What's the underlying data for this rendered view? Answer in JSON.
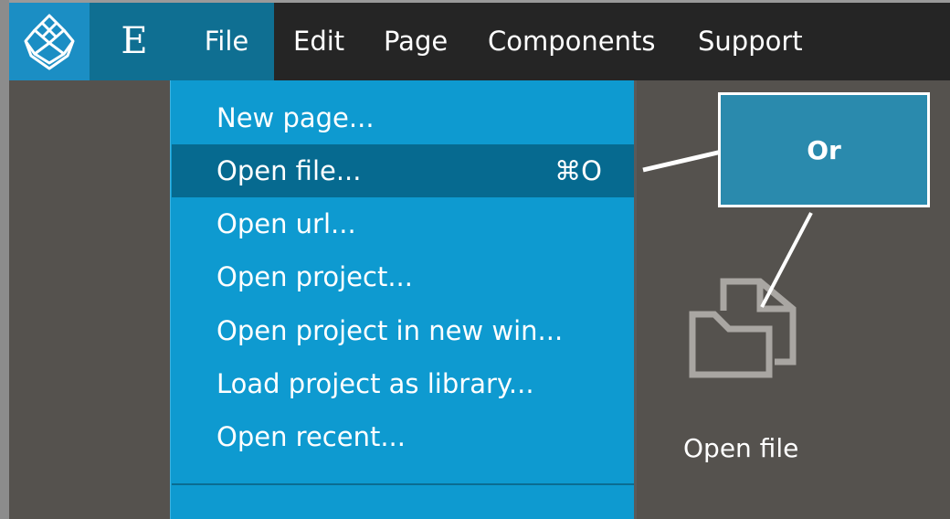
{
  "menubar": {
    "logo_icon": "pinecone-logo-icon",
    "e_tile": "E",
    "file": "File",
    "edit": "Edit",
    "page": "Page",
    "components": "Components",
    "support": "Support"
  },
  "file_menu": {
    "items": [
      {
        "label": "New page...",
        "shortcut": ""
      },
      {
        "label": "Open file...",
        "shortcut": "⌘O"
      },
      {
        "label": "Open url...",
        "shortcut": ""
      },
      {
        "label": "Open project...",
        "shortcut": ""
      },
      {
        "label": "Open project in new win...",
        "shortcut": ""
      },
      {
        "label": "Load project as library...",
        "shortcut": ""
      },
      {
        "label": "Open recent...",
        "shortcut": ""
      }
    ],
    "highlighted_index": 1
  },
  "panel": {
    "open_file_icon": "open-file-folder-icon",
    "open_file_label": "Open file"
  },
  "callout": {
    "text": "Or"
  },
  "colors": {
    "menubar_bg": "#252525",
    "logo_tile": "#1b8ec4",
    "active_tile": "#0f6f92",
    "dropdown_bg": "#0e9ad0",
    "dropdown_highlight": "#066a90",
    "callout_bg": "#2a8aad",
    "canvas_bg": "#55524e"
  }
}
